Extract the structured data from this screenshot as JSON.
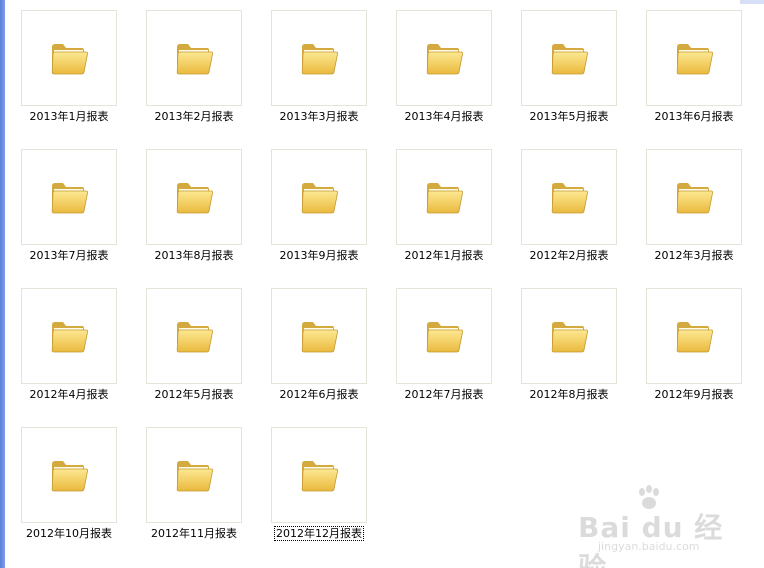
{
  "folders": [
    {
      "label": "2013年1月报表"
    },
    {
      "label": "2013年2月报表"
    },
    {
      "label": "2013年3月报表"
    },
    {
      "label": "2013年4月报表"
    },
    {
      "label": "2013年5月报表"
    },
    {
      "label": "2013年6月报表"
    },
    {
      "label": "2013年7月报表"
    },
    {
      "label": "2013年8月报表"
    },
    {
      "label": "2013年9月报表"
    },
    {
      "label": "2012年1月报表"
    },
    {
      "label": "2012年2月报表"
    },
    {
      "label": "2012年3月报表"
    },
    {
      "label": "2012年4月报表"
    },
    {
      "label": "2012年5月报表"
    },
    {
      "label": "2012年6月报表"
    },
    {
      "label": "2012年7月报表"
    },
    {
      "label": "2012年8月报表"
    },
    {
      "label": "2012年9月报表"
    },
    {
      "label": "2012年10月报表"
    },
    {
      "label": "2012年11月报表"
    },
    {
      "label": "2012年12月报表",
      "selected": true
    }
  ],
  "folder_icon": "folder-icon",
  "watermark": {
    "brand": "Bai du 经验",
    "url": "jingyan.baidu.com"
  },
  "colors": {
    "folder_body": "#f6d66a",
    "folder_dark": "#c9a23a",
    "window_border": "#5a7edc"
  }
}
